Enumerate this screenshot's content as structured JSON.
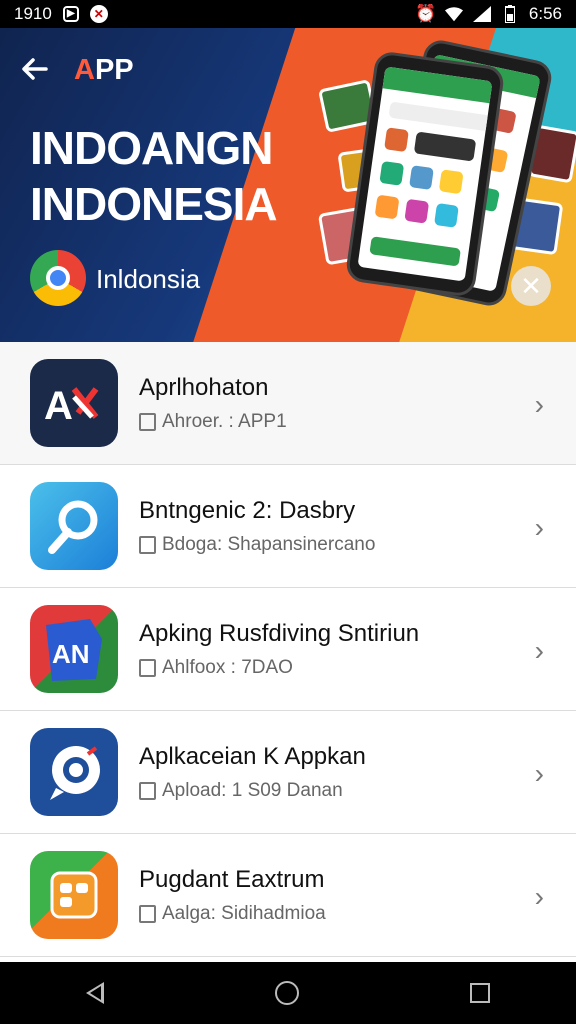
{
  "status_bar": {
    "left_time": "1910",
    "right_time": "6:56",
    "icons_left": [
      "app-notification-icon",
      "app-notification-icon"
    ],
    "icons_right": [
      "alarm-icon",
      "wifi-icon",
      "signal-icon",
      "battery-icon"
    ]
  },
  "banner": {
    "brand": "APP",
    "brand_accent": "A",
    "brand_rest": "PP",
    "headline_line1": "INDOANGN",
    "headline_line2": "INDONESIA",
    "country": "Inldonsia",
    "colors": {
      "navy": "#10244f",
      "orange": "#ee5a2a",
      "yellow": "#f4b32a",
      "teal": "#2fb8c9"
    }
  },
  "apps": [
    {
      "title": "Aprlhohaton",
      "subtitle": "Ahroer. : APP1",
      "icon": "ax-logo-icon"
    },
    {
      "title": "Bntngenic 2: Dasbry",
      "subtitle": "Bdoga: Shapansinercano",
      "icon": "blue-search-app-icon"
    },
    {
      "title": "Apking Rusfdiving Sntiriun",
      "subtitle": "Ahlfoox : 7DAO",
      "icon": "an-cube-icon"
    },
    {
      "title": "Aplkaceian K Appkan",
      "subtitle": "Apload: 1 S09 Danan",
      "icon": "chat-bubble-app-icon"
    },
    {
      "title": "Pugdant Eaxtrum",
      "subtitle": "Aalga: Sidihadmioa",
      "icon": "orange-green-app-icon"
    }
  ],
  "chevron": "›"
}
